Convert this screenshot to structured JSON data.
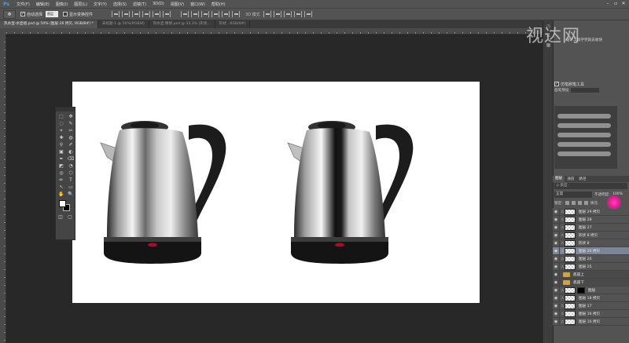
{
  "app": {
    "logo": "Ps",
    "menu": [
      "文件(F)",
      "编辑(E)",
      "图像(I)",
      "图层(L)",
      "文字(Y)",
      "选择(S)",
      "滤镜(T)",
      "3D(D)",
      "视图(V)",
      "窗口(W)",
      "帮助(H)"
    ],
    "window_controls": [
      "–",
      "▫",
      "✕"
    ]
  },
  "options_bar": {
    "tool_icon": "move-tool-icon",
    "auto_select_label": "自动选择",
    "auto_select_target": "图层",
    "show_transform_label": "显示变换控件",
    "mode3d_label": "3D 模式"
  },
  "tabs": [
    {
      "label": "热水壶-水壶组.psd @ 50% (图层 26 拷贝, RGB/8#) *",
      "active": true
    },
    {
      "label": "未标题-1 @ 50%(RGB/8)",
      "active": false
    },
    {
      "label": "热水壶 精修.psd @ 33.3% (形状...",
      "active": false
    },
    {
      "label": "形状...RGB/8#)",
      "active": false
    }
  ],
  "watermark": {
    "main": "视达网",
    "sub": "设计工具学完就去收快"
  },
  "brush_panel": {
    "header": "仿笔刷笔工具",
    "sub_label": "画笔预设"
  },
  "layers_panel": {
    "tabs": [
      {
        "label": "图层",
        "active": true
      },
      {
        "label": "通道",
        "active": false
      },
      {
        "label": "路径",
        "active": false
      }
    ],
    "filter": "p 类型",
    "blend_mode": "正常",
    "opacity_label": "不透明度:",
    "opacity_value": "100%",
    "lock_label": "锁定:",
    "fill_label": "填充:",
    "layers": [
      {
        "name": "图层 29 拷贝",
        "type": "layer",
        "selected": false
      },
      {
        "name": "图层 28",
        "type": "layer",
        "selected": false
      },
      {
        "name": "图层 27",
        "type": "layer",
        "selected": false
      },
      {
        "name": "形状 8 拷贝",
        "type": "layer",
        "selected": false
      },
      {
        "name": "形状 8",
        "type": "layer",
        "selected": false
      },
      {
        "name": "图层 26 拷贝",
        "type": "layer",
        "selected": true
      },
      {
        "name": "图层 26",
        "type": "layer",
        "selected": false
      },
      {
        "name": "图层 25",
        "type": "layer",
        "selected": false
      },
      {
        "name": "底座上",
        "type": "group",
        "selected": false
      },
      {
        "name": "底座下",
        "type": "group",
        "selected": false
      },
      {
        "name": "图层",
        "type": "mask",
        "selected": false
      },
      {
        "name": "图层 18 拷贝",
        "type": "layer",
        "selected": false
      },
      {
        "name": "图层 17",
        "type": "layer",
        "selected": false
      },
      {
        "name": "图层 16 拷贝",
        "type": "layer",
        "selected": false
      },
      {
        "name": "图层 16 拷贝",
        "type": "layer",
        "selected": false
      }
    ]
  },
  "toolbox": {
    "tools": [
      "⬚",
      "✥",
      "◌",
      "✎",
      "⌖",
      "✂",
      "✚",
      "◍",
      "⚲",
      "✐",
      "▣",
      "◐",
      "✒",
      "⌫",
      "◩",
      "◔",
      "◎",
      "⬡",
      "✏",
      "T",
      "↖",
      "▭",
      "✋",
      "🔍"
    ],
    "bottom": [
      "◫",
      "▢"
    ]
  }
}
